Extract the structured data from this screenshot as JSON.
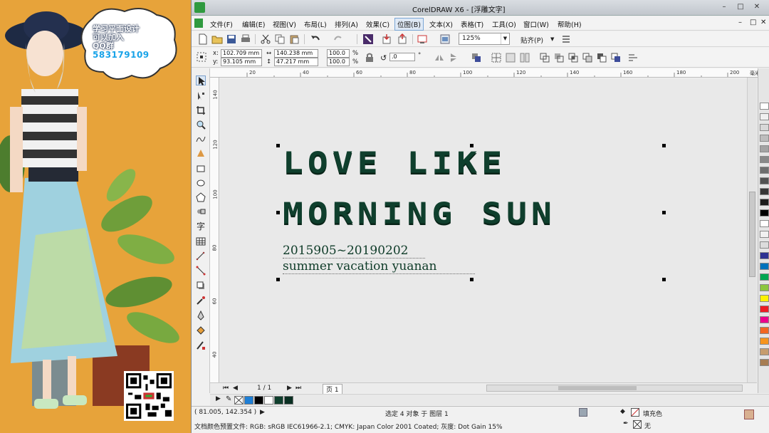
{
  "promo": {
    "line1": "学习平面设计",
    "line2": "可以加入",
    "line3": "QQ群",
    "qq_number": "583179109"
  },
  "window": {
    "title": "CorelDRAW X6 - [浮雕文字]",
    "controls": [
      "–",
      "□",
      "✕"
    ]
  },
  "menu": {
    "items": [
      "文件(F)",
      "编辑(E)",
      "视图(V)",
      "布局(L)",
      "排列(A)",
      "效果(C)",
      "位图(B)",
      "文本(X)",
      "表格(T)",
      "工具(O)",
      "窗口(W)",
      "帮助(H)"
    ],
    "active_index": 6
  },
  "toolbar": {
    "zoom": "125%",
    "snap_label": "贴齐(P)"
  },
  "properties": {
    "x_label": "x:",
    "y_label": "y:",
    "x_value": "102.709 mm",
    "y_value": "93.105 mm",
    "width": "140.238 mm",
    "height": "47.217 mm",
    "scale_x": "100.0",
    "scale_y": "100.0",
    "pct": "%",
    "rotation": ".0",
    "degree": "°"
  },
  "ruler": {
    "h_ticks": [
      "20",
      "40",
      "60",
      "80",
      "100",
      "120",
      "140",
      "160",
      "180",
      "200"
    ],
    "h_unit": "毫米",
    "v_ticks": [
      "140",
      "120",
      "100",
      "80",
      "60",
      "40"
    ]
  },
  "artwork": {
    "line1": "LOVE LIKE",
    "line2": "MORNING SUN",
    "date_line": "2015905~20190202",
    "sub_line": "summer vacation yuanan"
  },
  "pagebar": {
    "page_indicator": "1 / 1",
    "page_tab": "页 1"
  },
  "status": {
    "cursor_pos": "( 81.005, 142.354 )",
    "selection": "选定 4 对象 于 图层 1",
    "fill_label": "填充色",
    "outline_label": "无",
    "color_profile": "文档颜色预置文件: RGB: sRGB IEC61966-2.1; CMYK: Japan Color 2001 Coated; 灰度: Dot Gain 15%"
  },
  "colors": {
    "text_dark_green": "#0f3f2d",
    "promo_bg": "#e7a33a",
    "palette": [
      "#ffffff",
      "#f0f0f0",
      "#d8d8d8",
      "#bdbdbd",
      "#a3a3a3",
      "#888888",
      "#6e6e6e",
      "#525252",
      "#363636",
      "#1c1c1c",
      "#000000",
      "#ffffff",
      "#f1f1f1",
      "#dcdcdc",
      "#2e3192",
      "#0072bc",
      "#00a651",
      "#8dc63f",
      "#fff200",
      "#ed1c24",
      "#ec008c",
      "#f26522",
      "#f7941d",
      "#c69c6d",
      "#a67c52"
    ],
    "doc_palette": [
      "#1e7fd6",
      "#000000",
      "#ffffff",
      "#0f3f2d",
      "#0a2f22"
    ]
  }
}
